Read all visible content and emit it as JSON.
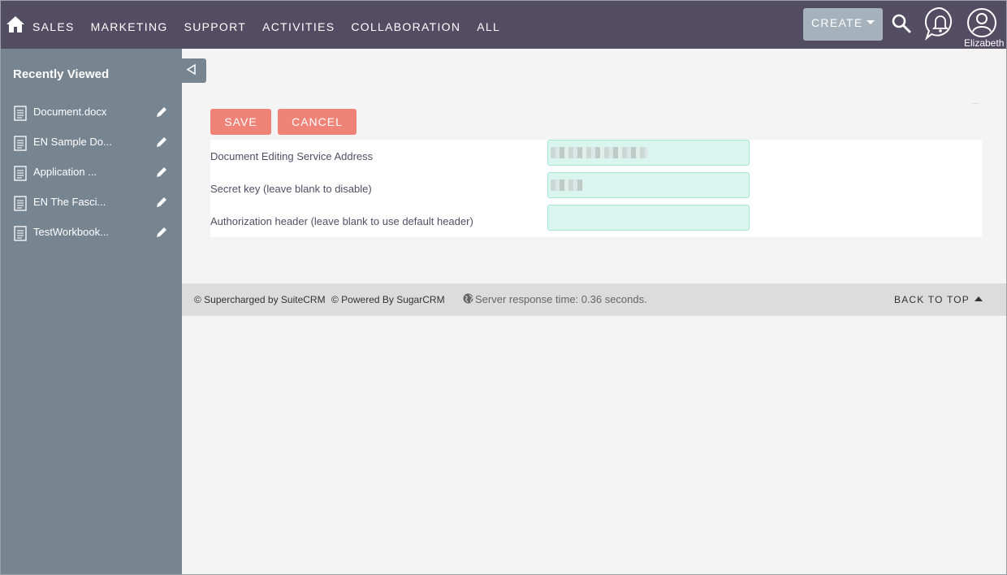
{
  "nav": {
    "items": [
      {
        "label": "SALES"
      },
      {
        "label": "MARKETING"
      },
      {
        "label": "SUPPORT"
      },
      {
        "label": "ACTIVITIES"
      },
      {
        "label": "COLLABORATION"
      },
      {
        "label": "ALL"
      }
    ],
    "create_label": "CREATE",
    "user_name": "Elizabeth",
    "icons": [
      "home-icon",
      "search-icon",
      "bell-icon",
      "user-icon"
    ]
  },
  "sidebar": {
    "title": "Recently Viewed",
    "items": [
      {
        "label": "Document.docx"
      },
      {
        "label": "EN Sample Do..."
      },
      {
        "label": "Application ..."
      },
      {
        "label": "EN The Fasci..."
      },
      {
        "label": "TestWorkbook..."
      }
    ]
  },
  "form": {
    "save_label": "SAVE",
    "cancel_label": "CANCEL",
    "fields": [
      {
        "label": "Document Editing Service Address",
        "value": ""
      },
      {
        "label": "Secret key (leave blank to disable)",
        "value": ""
      },
      {
        "label": "Authorization header (leave blank to use default header)",
        "value": ""
      }
    ]
  },
  "footer": {
    "suitecrm": "© Supercharged by SuiteCRM",
    "sugarcrm": "© Powered By SugarCRM",
    "server_time": "Server response time: 0.36 seconds.",
    "back_to_top": "BACK TO TOP"
  },
  "colors": {
    "nav_bg": "#534d64",
    "sidebar_bg": "#778591",
    "button_bg": "#f08377",
    "create_bg": "#a5b2bc",
    "input_bg": "#d8f5ee"
  }
}
